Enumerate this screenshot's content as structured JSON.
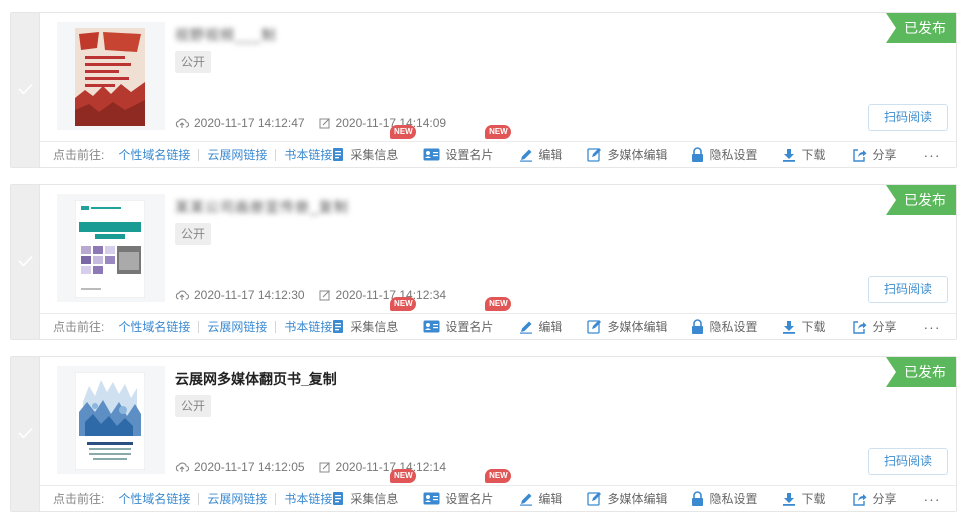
{
  "colors": {
    "published": "#5cb85c",
    "link": "#3b8ad1",
    "badge": "#e05555",
    "icon": "#3b8ad1"
  },
  "common": {
    "goto_label": "点击前往:",
    "links": [
      "个性域名链接",
      "云展网链接",
      "书本链接"
    ],
    "actions": {
      "collect": "采集信息",
      "card": "设置名片",
      "edit": "编辑",
      "media": "多媒体编辑",
      "privacy": "隐私设置",
      "download": "下载",
      "share": "分享"
    },
    "new_badge": "NEW",
    "more": "···",
    "scan_button": "扫码阅读"
  },
  "items": [
    {
      "title": "视野视频___制",
      "title_obscured": true,
      "visibility": "公开",
      "status": "已发布",
      "upload_time": "2020-11-17 14:12:47",
      "edit_time": "2020-11-17 14:14:09",
      "thumbnail_icon": "poster-thumbnail-icon"
    },
    {
      "title": "某某公司画册宣传册_复制",
      "title_obscured": true,
      "visibility": "公开",
      "status": "已发布",
      "upload_time": "2020-11-17 14:12:30",
      "edit_time": "2020-11-17 14:12:34",
      "thumbnail_icon": "brochure-thumbnail-icon"
    },
    {
      "title": "云展网多媒体翻页书_复制",
      "title_obscured": false,
      "visibility": "公开",
      "status": "已发布",
      "upload_time": "2020-11-17 14:12:05",
      "edit_time": "2020-11-17 14:12:14",
      "thumbnail_icon": "ebook-thumbnail-icon"
    }
  ]
}
